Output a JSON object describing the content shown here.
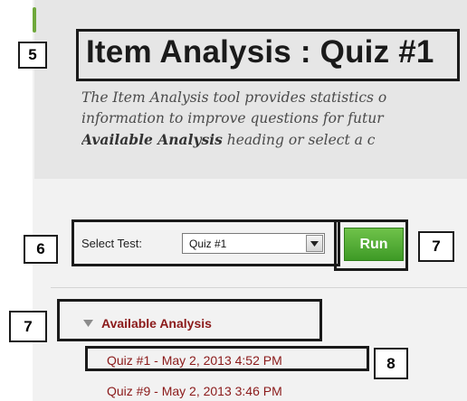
{
  "page": {
    "title": "Item Analysis : Quiz #1",
    "description_lines": [
      "The Item Analysis tool provides statistics o",
      "information to improve questions for futur"
    ],
    "description_bold": "Available Analysis",
    "description_tail": " heading or select a c"
  },
  "select_test": {
    "label": "Select Test:",
    "value": "Quiz #1"
  },
  "run_button": {
    "label": "Run"
  },
  "available_analysis": {
    "heading": "Available Analysis",
    "items": [
      "Quiz #1 - May 2, 2013 4:52 PM",
      "Quiz #9 - May 2, 2013 3:46 PM"
    ]
  },
  "callouts": [
    "5",
    "6",
    "7",
    "7",
    "8"
  ],
  "icons": {
    "dropdown": "chevron-down-icon",
    "collapse": "triangle-down-icon"
  },
  "colors": {
    "run_green": "#4ca832",
    "link_red": "#8b1a1a",
    "accent_green": "#6fa83b"
  }
}
